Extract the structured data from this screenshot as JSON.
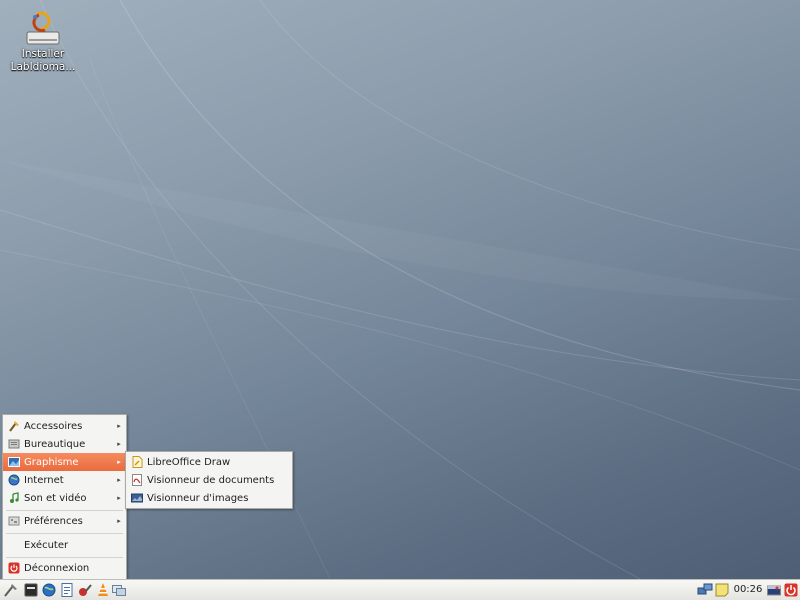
{
  "desktop": {
    "icons": [
      {
        "label_line1": "Installer",
        "label_line2": "LabIdioma..."
      }
    ]
  },
  "start_menu": {
    "items": [
      {
        "label": "Accessoires",
        "icon": "accessories-icon",
        "has_submenu": true
      },
      {
        "label": "Bureautique",
        "icon": "office-icon",
        "has_submenu": true
      },
      {
        "label": "Graphisme",
        "icon": "graphics-icon",
        "has_submenu": true,
        "active": true
      },
      {
        "label": "Internet",
        "icon": "internet-globe-icon",
        "has_submenu": true
      },
      {
        "label": "Son et vidéo",
        "icon": "music-note-icon",
        "has_submenu": true
      },
      {
        "label": "Préférences",
        "icon": "preferences-icon",
        "has_submenu": true
      },
      {
        "label": "Exécuter",
        "icon": "",
        "has_submenu": false
      },
      {
        "label": "Déconnexion",
        "icon": "logout-icon",
        "has_submenu": false
      }
    ],
    "submenu_arrow": "▸"
  },
  "graphics_submenu": {
    "items": [
      {
        "label": "LibreOffice Draw",
        "icon": "libreoffice-draw-icon"
      },
      {
        "label": "Visionneur de documents",
        "icon": "document-viewer-icon"
      },
      {
        "label": "Visionneur d'images",
        "icon": "image-viewer-icon"
      }
    ]
  },
  "taskbar": {
    "launchers": [
      "menu-icon",
      "terminal-icon",
      "browser-globe-icon",
      "text-editor-icon",
      "media-icon",
      "vlc-cone-icon",
      "window-switcher-icon"
    ],
    "tray": [
      "network-icon",
      "notes-icon"
    ],
    "clock": "00:26",
    "tray_right": [
      "keyboard-flag-icon",
      "power-icon"
    ]
  },
  "colors": {
    "menu_active": "#ea6a3d",
    "desktop_top": "#a1b0bd",
    "desktop_bottom": "#4e5e75"
  }
}
